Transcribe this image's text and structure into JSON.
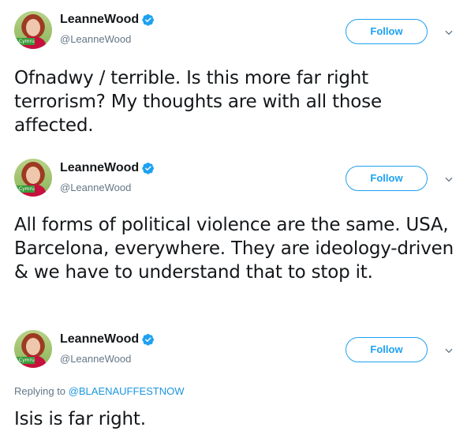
{
  "tweets": [
    {
      "author": {
        "name": "LeanneWood",
        "handle": "@LeanneWood",
        "verified": true
      },
      "follow_label": "Follow",
      "text": "Ofnadwy / terrible. Is this more far right terrorism? My thoughts are with all those affected."
    },
    {
      "author": {
        "name": "LeanneWood",
        "handle": "@LeanneWood",
        "verified": true
      },
      "follow_label": "Follow",
      "text": "All forms of political violence are the same. USA, Barcelona, everywhere. They are ideology-driven & we have to understand that to stop it."
    },
    {
      "author": {
        "name": "LeanneWood",
        "handle": "@LeanneWood",
        "verified": true
      },
      "follow_label": "Follow",
      "replying_to_prefix": "Replying to",
      "replying_to_handle": "@BLAENAUFFESTNOW",
      "text": "Isis is far right."
    }
  ],
  "avatar_badge_text": "d Cymru",
  "colors": {
    "accent": "#1da1f2",
    "link": "#1b95e0",
    "text": "#14171a",
    "secondary": "#657786"
  },
  "icons": {
    "verified": "verified-badge-icon",
    "caret": "chevron-down-icon"
  }
}
